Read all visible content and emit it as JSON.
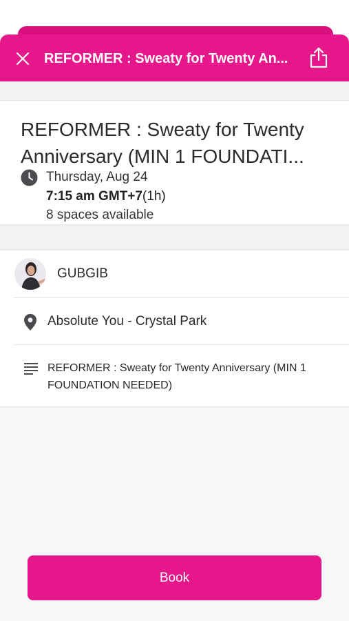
{
  "header": {
    "title": "REFORMER : Sweaty for Twenty An...",
    "close_icon": "close-icon",
    "share_icon": "share-icon",
    "accent": "#e5178b"
  },
  "class": {
    "title_line1": "REFORMER : Sweaty for Twenty",
    "title_line2": "Anniversary (MIN 1 FOUNDATI...",
    "date": "Thursday, Aug 24",
    "time": "7:15 am GMT+7",
    "duration": "(1h)",
    "spaces": "8 spaces available"
  },
  "details": {
    "instructor": "GUBGIB",
    "location": "Absolute You - Crystal Park",
    "description": "REFORMER : Sweaty for Twenty Anniversary (MIN 1 FOUNDATION NEEDED)"
  },
  "footer": {
    "book_label": "Book"
  }
}
